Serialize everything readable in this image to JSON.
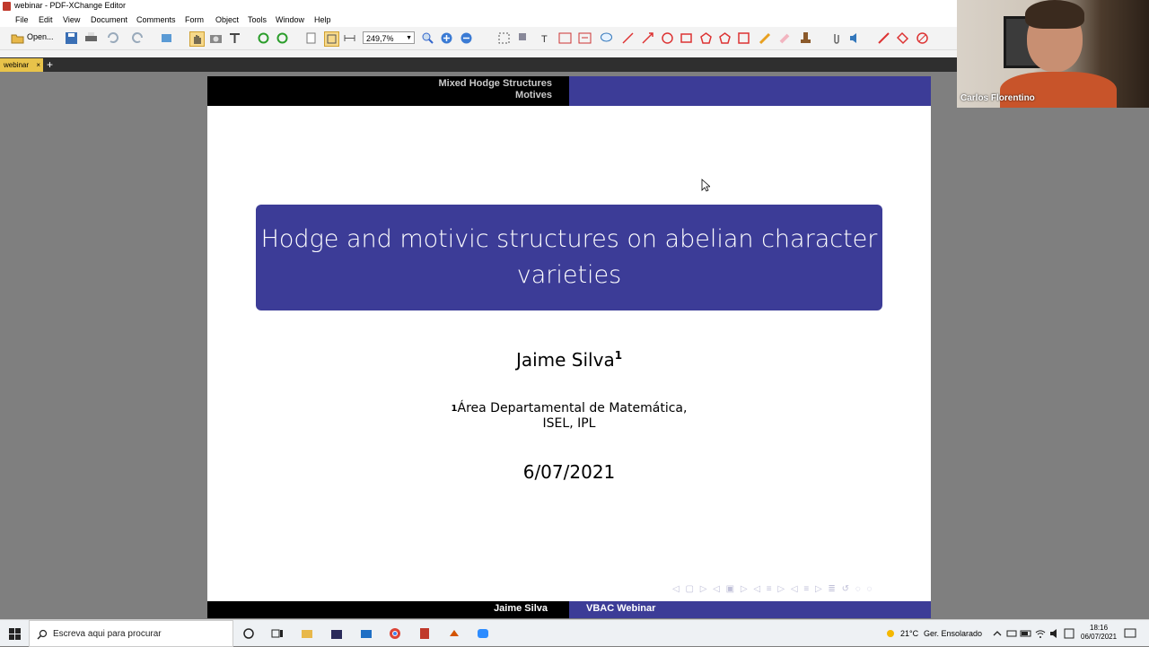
{
  "window": {
    "title": "webinar - PDF-XChange Editor"
  },
  "menu": [
    "File",
    "Edit",
    "View",
    "Document",
    "Comments",
    "Form",
    "Object",
    "Tools",
    "Window",
    "Help"
  ],
  "toolbar": {
    "open_label": "Open...",
    "zoom_value": "249,7%"
  },
  "tabs": {
    "active": "webinar",
    "close": "×",
    "add": "+"
  },
  "slide": {
    "header_line1": "Mixed Hodge Structures",
    "header_line2": "Motives",
    "title": "Hodge and motivic structures on abelian character varieties",
    "author": "Jaime Silva",
    "author_sup": "1",
    "affil_sup": "1",
    "affil_line1": "Área Departamental de Matemática,",
    "affil_line2": "ISEL, IPL",
    "date": "6/07/2021",
    "footer_left": "Jaime Silva",
    "footer_right": "VBAC Webinar"
  },
  "webcam": {
    "name": "Carlos Florentino"
  },
  "taskbar": {
    "search_placeholder": "Escreva aqui para procurar",
    "temperature": "21°C",
    "weather": "Ger. Ensolarado",
    "time": "18:16",
    "date": "06/07/2021"
  },
  "colors": {
    "beamer_blue": "#3c3c97",
    "tab_active": "#e8c34a"
  }
}
